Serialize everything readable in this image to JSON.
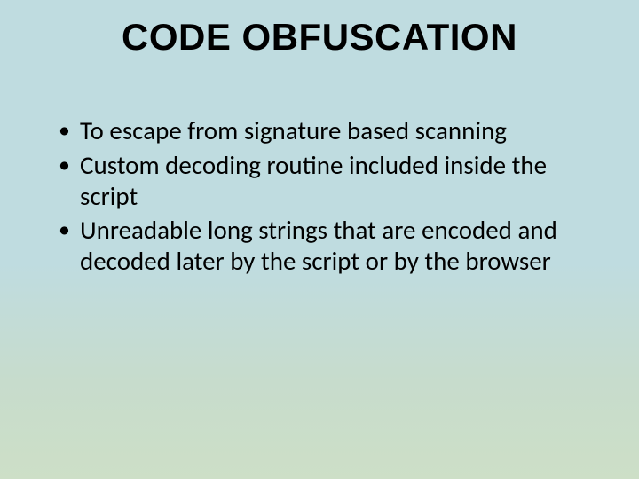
{
  "title": "CODE OBFUSCATION",
  "bullets": [
    "To escape from signature based scanning",
    "Custom decoding routine included inside the script",
    "Unreadable long strings that are encoded and decoded later by the script or by the browser"
  ]
}
